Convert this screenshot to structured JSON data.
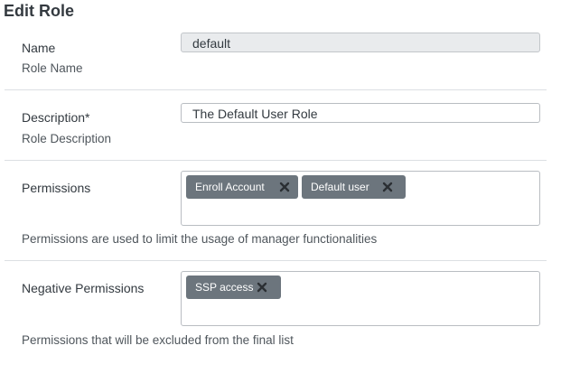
{
  "page": {
    "title": "Edit Role"
  },
  "name": {
    "label": "Name",
    "sublabel": "Role Name",
    "value": "default"
  },
  "description": {
    "label": "Description*",
    "sublabel": "Role Description",
    "value": "The Default User Role"
  },
  "permissions": {
    "label": "Permissions",
    "tags": [
      "Enroll Account",
      "Default user"
    ],
    "help": "Permissions are used to limit the usage of manager functionalities"
  },
  "negative_permissions": {
    "label": "Negative Permissions",
    "tags": [
      "SSP access"
    ],
    "help": "Permissions that will be excluded from the final list"
  },
  "colors": {
    "tag_bg": "#6c757d",
    "tag_text": "#ffffff",
    "readonly_bg": "#e9ebed"
  },
  "icons": {
    "tag_remove": "close-icon"
  }
}
